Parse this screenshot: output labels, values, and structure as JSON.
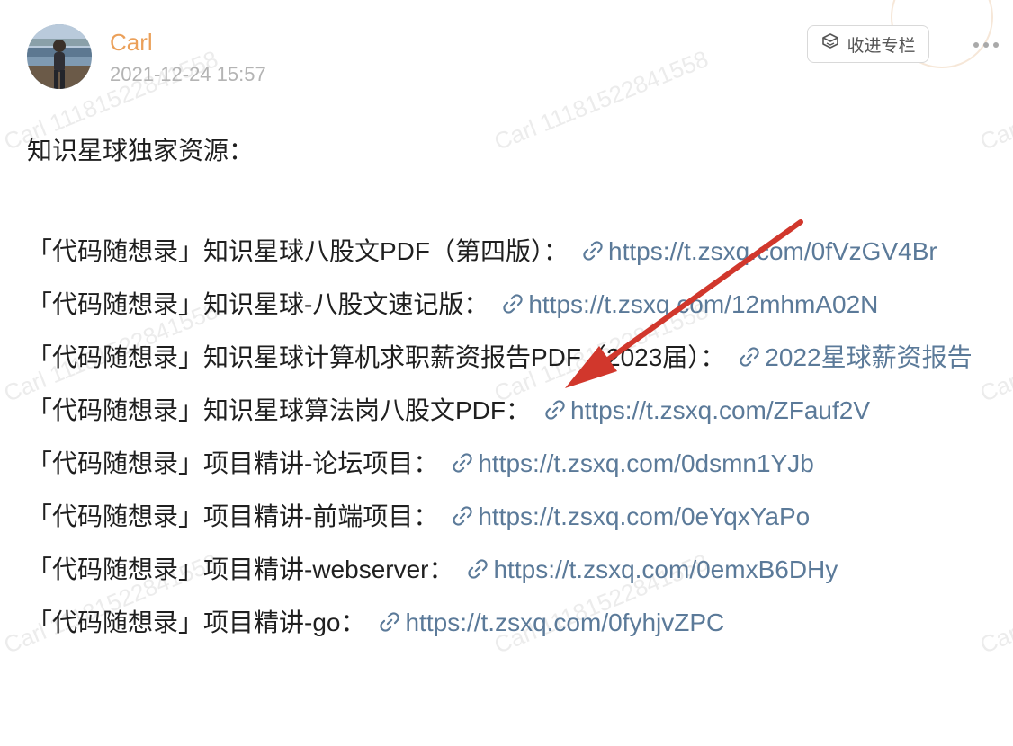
{
  "author": {
    "name": "Carl",
    "time": "2021-12-24 15:57"
  },
  "watermark": {
    "text": "Carl 11181522841558",
    "short": "Carl"
  },
  "header": {
    "column_button_label": "收进专栏",
    "column_icon": "box-bookmark-icon",
    "more_icon": "more-dots-icon"
  },
  "post": {
    "intro": "知识星球独家资源：",
    "items": [
      {
        "prefix": "「代码随想录」知识星球八股文PDF（第四版）：",
        "link": "https://t.zsxq.com/0fVzGV4Br"
      },
      {
        "prefix": "「代码随想录」知识星球-八股文速记版：",
        "link": "https://t.zsxq.com/12mhmA02N"
      },
      {
        "prefix": "「代码随想录」知识星球计算机求职薪资报告PDF（2023届）：",
        "link": "2022星球薪资报告"
      },
      {
        "prefix": "「代码随想录」知识星球算法岗八股文PDF：",
        "link": "https://t.zsxq.com/ZFauf2V"
      },
      {
        "prefix": "「代码随想录」项目精讲-论坛项目：",
        "link": "https://t.zsxq.com/0dsmn1YJb"
      },
      {
        "prefix": "「代码随想录」项目精讲-前端项目：",
        "link": "https://t.zsxq.com/0eYqxYaPo"
      },
      {
        "prefix": "「代码随想录」项目精讲-webserver：",
        "link": "https://t.zsxq.com/0emxB6DHy"
      },
      {
        "prefix": "「代码随想录」项目精讲-go：",
        "link": "https://t.zsxq.com/0fyhjvZPC"
      }
    ]
  },
  "colors": {
    "author_name": "#eba05a",
    "link": "#5b7a99",
    "annotation_arrow": "#d1372c"
  }
}
